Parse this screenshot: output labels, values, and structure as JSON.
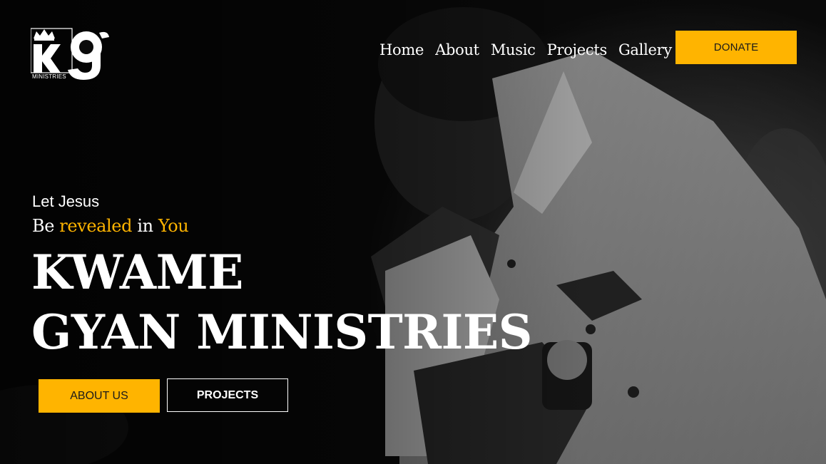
{
  "logo": {
    "letters": "kg",
    "subtext": "MINISTRIES",
    "crown_icon": "crown-icon"
  },
  "nav": {
    "items": [
      {
        "label": "Home"
      },
      {
        "label": "About"
      },
      {
        "label": "Music"
      },
      {
        "label": "Projects"
      },
      {
        "label": "Gallery"
      }
    ],
    "donate_label": "DONATE"
  },
  "hero": {
    "tagline_line1": "Let Jesus",
    "tagline_line2": {
      "be": "Be",
      "revealed": "revealed",
      "in": "in",
      "you": "You"
    },
    "title_line1": "KWAME",
    "title_line2": "GYAN MINISTRIES",
    "about_button": "ABOUT US",
    "projects_button": "PROJECTS"
  },
  "colors": {
    "accent": "#ffb400",
    "background": "#0a0a0a",
    "text": "#ffffff"
  }
}
